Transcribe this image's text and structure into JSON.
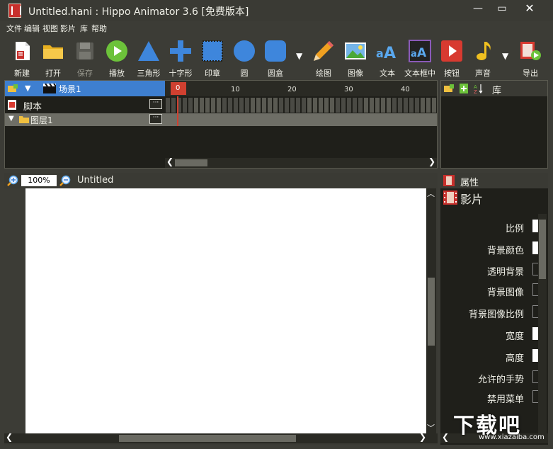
{
  "window": {
    "title": "Untitled.hani : Hippo Animator 3.6 [免费版本]",
    "minimize": "—",
    "maximize": "▭",
    "close": "✕"
  },
  "menu": [
    "文件",
    "编辑",
    "视图",
    "影片",
    "库",
    "帮助"
  ],
  "toolbar": [
    {
      "label": "新建",
      "icon": "new-file-icon",
      "disabled": false
    },
    {
      "label": "打开",
      "icon": "folder-icon",
      "disabled": false
    },
    {
      "label": "保存",
      "icon": "save-icon",
      "disabled": true
    },
    {
      "label": "播放",
      "icon": "play-icon",
      "disabled": false
    },
    {
      "label": "三角形",
      "icon": "triangle-icon",
      "disabled": false
    },
    {
      "label": "十字形",
      "icon": "cross-icon",
      "disabled": false
    },
    {
      "label": "印章",
      "icon": "stamp-icon",
      "disabled": false
    },
    {
      "label": "圆",
      "icon": "circle-icon",
      "disabled": false
    },
    {
      "label": "圆盒",
      "icon": "rounded-box-icon",
      "disabled": false
    },
    {
      "label": "绘图",
      "icon": "pencil-icon",
      "disabled": false
    },
    {
      "label": "图像",
      "icon": "image-icon",
      "disabled": false
    },
    {
      "label": "文本",
      "icon": "text-icon",
      "disabled": false
    },
    {
      "label": "文本框中",
      "icon": "textbox-icon",
      "disabled": false
    },
    {
      "label": "按钮",
      "icon": "button-icon",
      "disabled": false
    },
    {
      "label": "声音",
      "icon": "sound-icon",
      "disabled": false
    },
    {
      "label": "导出",
      "icon": "export-icon",
      "disabled": false
    }
  ],
  "timeline": {
    "scene_label": "场景1",
    "script_label": "脚本",
    "layer_label": "图层1",
    "dots": "···",
    "ruler_numbers": [
      "0",
      "10",
      "20",
      "30",
      "40"
    ],
    "current_frame": 0
  },
  "library": {
    "title": "库"
  },
  "canvas": {
    "zoom": "100%",
    "doc_name": "Untitled"
  },
  "properties": {
    "title": "属性",
    "subtitle": "影片",
    "rows": [
      "比例",
      "背景颜色",
      "透明背景",
      "背景图像",
      "背景图像比例",
      "宽度",
      "高度",
      "允许的手势",
      "禁用菜单"
    ]
  },
  "watermark": {
    "text": "下载吧",
    "url": "www.xiazaiba.com"
  },
  "colors": {
    "accent_blue": "#3e7fd0",
    "playhead_red": "#d04030",
    "panel_dark": "#1f1f1a",
    "chrome": "#3a3a34"
  }
}
